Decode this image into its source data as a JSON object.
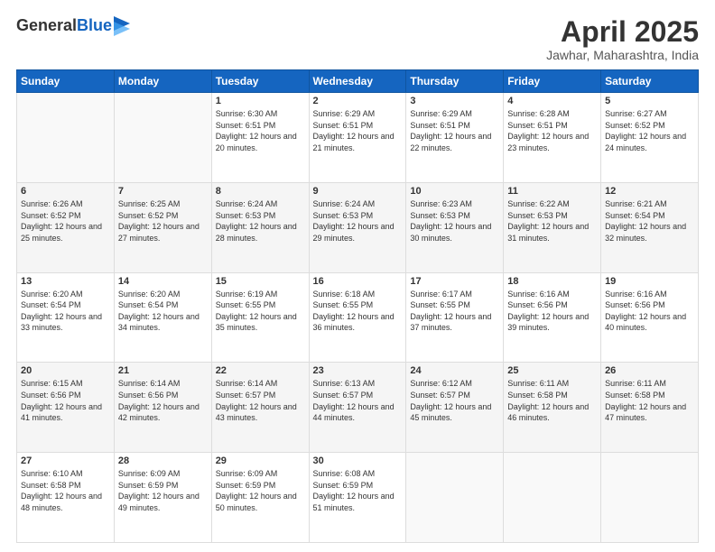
{
  "logo": {
    "general": "General",
    "blue": "Blue"
  },
  "header": {
    "title": "April 2025",
    "location": "Jawhar, Maharashtra, India"
  },
  "days_of_week": [
    "Sunday",
    "Monday",
    "Tuesday",
    "Wednesday",
    "Thursday",
    "Friday",
    "Saturday"
  ],
  "weeks": [
    [
      {
        "day": "",
        "detail": ""
      },
      {
        "day": "",
        "detail": ""
      },
      {
        "day": "1",
        "detail": "Sunrise: 6:30 AM\nSunset: 6:51 PM\nDaylight: 12 hours and 20 minutes."
      },
      {
        "day": "2",
        "detail": "Sunrise: 6:29 AM\nSunset: 6:51 PM\nDaylight: 12 hours and 21 minutes."
      },
      {
        "day": "3",
        "detail": "Sunrise: 6:29 AM\nSunset: 6:51 PM\nDaylight: 12 hours and 22 minutes."
      },
      {
        "day": "4",
        "detail": "Sunrise: 6:28 AM\nSunset: 6:51 PM\nDaylight: 12 hours and 23 minutes."
      },
      {
        "day": "5",
        "detail": "Sunrise: 6:27 AM\nSunset: 6:52 PM\nDaylight: 12 hours and 24 minutes."
      }
    ],
    [
      {
        "day": "6",
        "detail": "Sunrise: 6:26 AM\nSunset: 6:52 PM\nDaylight: 12 hours and 25 minutes."
      },
      {
        "day": "7",
        "detail": "Sunrise: 6:25 AM\nSunset: 6:52 PM\nDaylight: 12 hours and 27 minutes."
      },
      {
        "day": "8",
        "detail": "Sunrise: 6:24 AM\nSunset: 6:53 PM\nDaylight: 12 hours and 28 minutes."
      },
      {
        "day": "9",
        "detail": "Sunrise: 6:24 AM\nSunset: 6:53 PM\nDaylight: 12 hours and 29 minutes."
      },
      {
        "day": "10",
        "detail": "Sunrise: 6:23 AM\nSunset: 6:53 PM\nDaylight: 12 hours and 30 minutes."
      },
      {
        "day": "11",
        "detail": "Sunrise: 6:22 AM\nSunset: 6:53 PM\nDaylight: 12 hours and 31 minutes."
      },
      {
        "day": "12",
        "detail": "Sunrise: 6:21 AM\nSunset: 6:54 PM\nDaylight: 12 hours and 32 minutes."
      }
    ],
    [
      {
        "day": "13",
        "detail": "Sunrise: 6:20 AM\nSunset: 6:54 PM\nDaylight: 12 hours and 33 minutes."
      },
      {
        "day": "14",
        "detail": "Sunrise: 6:20 AM\nSunset: 6:54 PM\nDaylight: 12 hours and 34 minutes."
      },
      {
        "day": "15",
        "detail": "Sunrise: 6:19 AM\nSunset: 6:55 PM\nDaylight: 12 hours and 35 minutes."
      },
      {
        "day": "16",
        "detail": "Sunrise: 6:18 AM\nSunset: 6:55 PM\nDaylight: 12 hours and 36 minutes."
      },
      {
        "day": "17",
        "detail": "Sunrise: 6:17 AM\nSunset: 6:55 PM\nDaylight: 12 hours and 37 minutes."
      },
      {
        "day": "18",
        "detail": "Sunrise: 6:16 AM\nSunset: 6:56 PM\nDaylight: 12 hours and 39 minutes."
      },
      {
        "day": "19",
        "detail": "Sunrise: 6:16 AM\nSunset: 6:56 PM\nDaylight: 12 hours and 40 minutes."
      }
    ],
    [
      {
        "day": "20",
        "detail": "Sunrise: 6:15 AM\nSunset: 6:56 PM\nDaylight: 12 hours and 41 minutes."
      },
      {
        "day": "21",
        "detail": "Sunrise: 6:14 AM\nSunset: 6:56 PM\nDaylight: 12 hours and 42 minutes."
      },
      {
        "day": "22",
        "detail": "Sunrise: 6:14 AM\nSunset: 6:57 PM\nDaylight: 12 hours and 43 minutes."
      },
      {
        "day": "23",
        "detail": "Sunrise: 6:13 AM\nSunset: 6:57 PM\nDaylight: 12 hours and 44 minutes."
      },
      {
        "day": "24",
        "detail": "Sunrise: 6:12 AM\nSunset: 6:57 PM\nDaylight: 12 hours and 45 minutes."
      },
      {
        "day": "25",
        "detail": "Sunrise: 6:11 AM\nSunset: 6:58 PM\nDaylight: 12 hours and 46 minutes."
      },
      {
        "day": "26",
        "detail": "Sunrise: 6:11 AM\nSunset: 6:58 PM\nDaylight: 12 hours and 47 minutes."
      }
    ],
    [
      {
        "day": "27",
        "detail": "Sunrise: 6:10 AM\nSunset: 6:58 PM\nDaylight: 12 hours and 48 minutes."
      },
      {
        "day": "28",
        "detail": "Sunrise: 6:09 AM\nSunset: 6:59 PM\nDaylight: 12 hours and 49 minutes."
      },
      {
        "day": "29",
        "detail": "Sunrise: 6:09 AM\nSunset: 6:59 PM\nDaylight: 12 hours and 50 minutes."
      },
      {
        "day": "30",
        "detail": "Sunrise: 6:08 AM\nSunset: 6:59 PM\nDaylight: 12 hours and 51 minutes."
      },
      {
        "day": "",
        "detail": ""
      },
      {
        "day": "",
        "detail": ""
      },
      {
        "day": "",
        "detail": ""
      }
    ]
  ]
}
